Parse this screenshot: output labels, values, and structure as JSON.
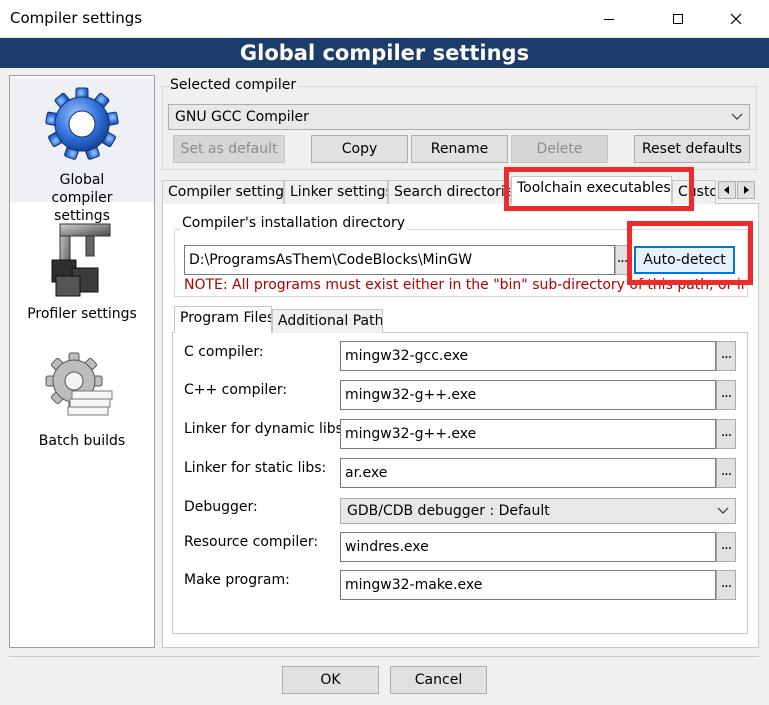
{
  "window": {
    "title": "Compiler settings",
    "controls": [
      "minimize-icon",
      "maximize-icon",
      "close-icon"
    ]
  },
  "header": {
    "title": "Global compiler settings"
  },
  "sidebar": {
    "items": [
      {
        "label": "Global compiler settings",
        "icon": "gear-icon",
        "selected": true
      },
      {
        "label": "Profiler settings",
        "icon": "caliper-icon",
        "selected": false
      },
      {
        "label": "Batch builds",
        "icon": "batch-gear-icon",
        "selected": false
      }
    ]
  },
  "compiler": {
    "group_label": "Selected compiler",
    "selected": "GNU GCC Compiler",
    "buttons": {
      "set_default": "Set as default",
      "copy": "Copy",
      "rename": "Rename",
      "delete": "Delete",
      "reset": "Reset defaults"
    }
  },
  "tabs": {
    "items": [
      "Compiler settings",
      "Linker settings",
      "Search directories",
      "Toolchain executables",
      "Custom"
    ],
    "active": "Toolchain executables"
  },
  "install": {
    "group_label": "Compiler's installation directory",
    "path": "D:\\ProgramsAsThem\\CodeBlocks\\MinGW",
    "browse": "...",
    "auto_detect": "Auto-detect",
    "note": "NOTE: All programs must exist either in the \"bin\" sub-directory of this path, or in"
  },
  "subtabs": {
    "items": [
      "Program Files",
      "Additional Paths"
    ],
    "active": "Program Files"
  },
  "programs": {
    "c_compiler": {
      "label": "C compiler:",
      "value": "mingw32-gcc.exe"
    },
    "cpp_compiler": {
      "label": "C++ compiler:",
      "value": "mingw32-g++.exe"
    },
    "linker_dynamic": {
      "label": "Linker for dynamic libs:",
      "value": "mingw32-g++.exe"
    },
    "linker_static": {
      "label": "Linker for static libs:",
      "value": "ar.exe"
    },
    "debugger": {
      "label": "Debugger:",
      "value": "GDB/CDB debugger : Default"
    },
    "resource": {
      "label": "Resource compiler:",
      "value": "windres.exe"
    },
    "make": {
      "label": "Make program:",
      "value": "mingw32-make.exe"
    },
    "browse": "..."
  },
  "footer": {
    "ok": "OK",
    "cancel": "Cancel"
  },
  "colors": {
    "banner": "#1c3c6c",
    "note": "#b00000",
    "highlight": "#ee2b2b",
    "focus": "#0078d7"
  }
}
